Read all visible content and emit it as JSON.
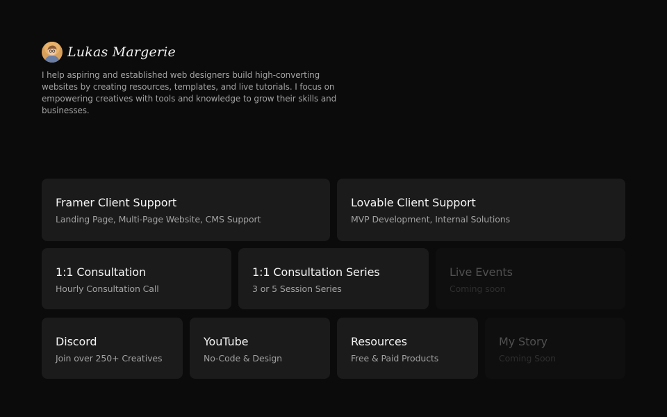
{
  "profile": {
    "name": "Lukas Margerie",
    "bio": "I help aspiring and established web designers build high-converting websites by creating resources, templates, and live tutorials. I focus on empowering creatives with tools and knowledge to grow their skills and businesses."
  },
  "cards": {
    "framer": {
      "title": "Framer Client Support",
      "subtitle": "Landing Page, Multi-Page Website, CMS Support"
    },
    "lovable": {
      "title": "Lovable Client Support",
      "subtitle": "MVP Development, Internal Solutions"
    },
    "consultation": {
      "title": "1:1 Consultation",
      "subtitle": "Hourly Consultation Call"
    },
    "consultation_series": {
      "title": "1:1 Consultation Series",
      "subtitle": "3 or 5 Session Series"
    },
    "live_events": {
      "title": "Live Events",
      "subtitle": "Coming soon"
    },
    "discord": {
      "title": "Discord",
      "subtitle": "Join over 250+ Creatives"
    },
    "youtube": {
      "title": "YouTube",
      "subtitle": "No-Code & Design"
    },
    "resources": {
      "title": "Resources",
      "subtitle": "Free & Paid Products"
    },
    "my_story": {
      "title": "My Story",
      "subtitle": "Coming Soon"
    }
  },
  "colors": {
    "background": "#0b0b0b",
    "card": "#1b1b1b",
    "card_disabled": "#0f0f0f",
    "title": "#f5f5f5",
    "subtitle": "#a1a1a1"
  }
}
